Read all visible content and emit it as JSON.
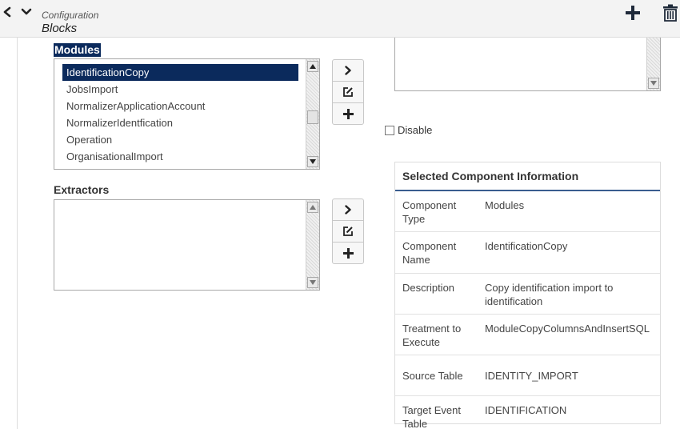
{
  "header": {
    "breadcrumb": "Configuration",
    "title": "Blocks",
    "icons": {
      "back": "chevron-left-icon",
      "down": "chevron-down-icon",
      "add": "plus-icon",
      "delete": "trash-icon"
    }
  },
  "modules": {
    "label": "Modules",
    "items": [
      {
        "label": "IdentificationCopy",
        "selected": true
      },
      {
        "label": "JobsImport"
      },
      {
        "label": "NormalizerApplicationAccount"
      },
      {
        "label": "NormalizerIdentfication"
      },
      {
        "label": "Operation"
      },
      {
        "label": "OrganisationalImport"
      }
    ]
  },
  "extractors": {
    "label": "Extractors",
    "items": []
  },
  "disable": {
    "label": "Disable",
    "checked": false
  },
  "info": {
    "title": "Selected Component Information",
    "rows": [
      {
        "key": "Component Type",
        "value": "Modules"
      },
      {
        "key": "Component Name",
        "value": "IdentificationCopy"
      },
      {
        "key": "Description",
        "value": "Copy identification import to identification"
      },
      {
        "key": "Treatment to Execute",
        "value": "ModuleCopyColumnsAndInsertSQL"
      },
      {
        "key": "Source Table",
        "value": "IDENTITY_IMPORT"
      },
      {
        "key": "Target Event Table",
        "value": "IDENTIFICATION"
      }
    ]
  },
  "colors": {
    "selection": "#0b2a5c",
    "accent": "#3a5d8f",
    "header_bg": "#f3f3f3"
  }
}
